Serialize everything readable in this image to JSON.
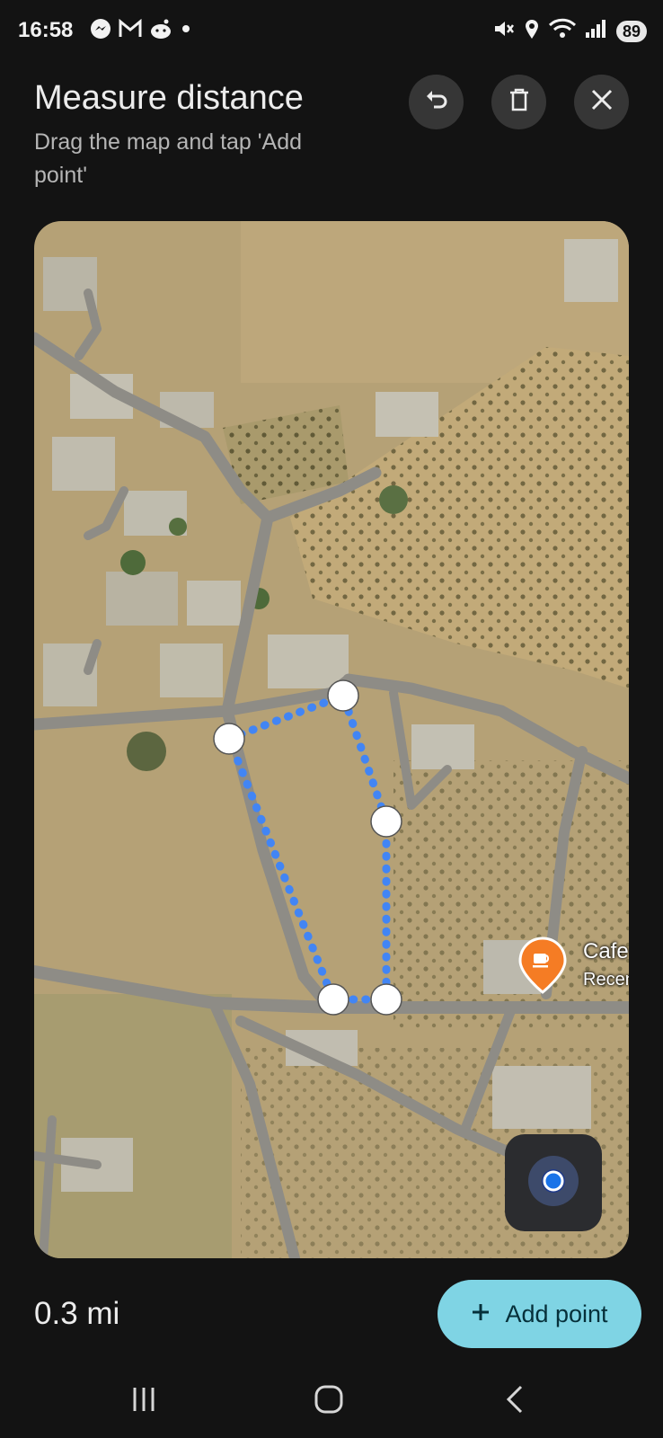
{
  "status_bar": {
    "time": "16:58",
    "battery": "89",
    "left_icons": [
      "messenger-icon",
      "gmail-icon",
      "reddit-icon",
      "dot-icon"
    ],
    "right_icons": [
      "mute-icon",
      "location-icon",
      "wifi-icon",
      "signal-icon",
      "battery-icon"
    ]
  },
  "header": {
    "title": "Measure distance",
    "subtitle": "Drag the map and tap 'Add point'"
  },
  "toolbar": {
    "undo_icon": "undo-icon",
    "delete_icon": "trash-icon",
    "close_icon": "close-icon"
  },
  "map": {
    "type": "satellite",
    "measure_color": "#4285f4",
    "points_count": 5,
    "poi": {
      "name": "Cafe",
      "subtitle": "Recen",
      "icon": "cafe-icon",
      "color": "#f57c24"
    },
    "my_location_icon": "my-location-icon"
  },
  "footer": {
    "distance": "0.3 mi",
    "add_point_label": "Add point",
    "add_point_icon": "plus-icon",
    "accent": "#7fd4e4"
  },
  "nav": {
    "recents_icon": "recents-icon",
    "home_icon": "home-icon",
    "back_icon": "back-icon"
  }
}
